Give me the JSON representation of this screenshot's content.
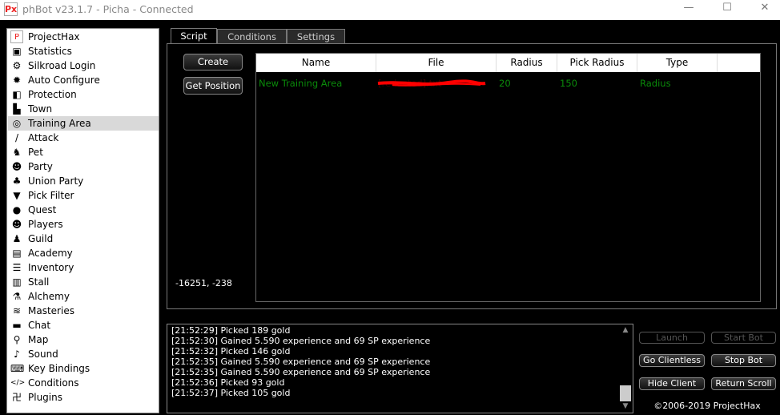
{
  "window": {
    "title": "phBot v23.1.7 - Picha - Connected",
    "logo": "Px"
  },
  "sidebar": {
    "items": [
      {
        "label": "ProjectHax",
        "icon": "projecthax-logo-icon"
      },
      {
        "label": "Statistics",
        "icon": "building-icon"
      },
      {
        "label": "Silkroad Login",
        "icon": "gears-icon"
      },
      {
        "label": "Auto Configure",
        "icon": "gear-a-icon"
      },
      {
        "label": "Protection",
        "icon": "shield-icon"
      },
      {
        "label": "Town",
        "icon": "town-icon"
      },
      {
        "label": "Training Area",
        "icon": "target-icon",
        "selected": true
      },
      {
        "label": "Attack",
        "icon": "sword-icon"
      },
      {
        "label": "Pet",
        "icon": "pet-icon"
      },
      {
        "label": "Party",
        "icon": "party-icon"
      },
      {
        "label": "Union Party",
        "icon": "union-icon"
      },
      {
        "label": "Pick Filter",
        "icon": "filter-icon"
      },
      {
        "label": "Quest",
        "icon": "quest-icon"
      },
      {
        "label": "Players",
        "icon": "players-icon"
      },
      {
        "label": "Guild",
        "icon": "guild-icon"
      },
      {
        "label": "Academy",
        "icon": "academy-icon"
      },
      {
        "label": "Inventory",
        "icon": "inventory-icon"
      },
      {
        "label": "Stall",
        "icon": "stall-icon"
      },
      {
        "label": "Alchemy",
        "icon": "alchemy-icon"
      },
      {
        "label": "Masteries",
        "icon": "masteries-icon"
      },
      {
        "label": "Chat",
        "icon": "chat-icon"
      },
      {
        "label": "Map",
        "icon": "map-pin-icon"
      },
      {
        "label": "Sound",
        "icon": "bell-icon"
      },
      {
        "label": "Key Bindings",
        "icon": "keyboard-icon"
      },
      {
        "label": "Conditions",
        "icon": "code-icon"
      },
      {
        "label": "Plugins",
        "icon": "plugins-icon"
      }
    ]
  },
  "tabs": [
    {
      "label": "Script",
      "active": true
    },
    {
      "label": "Conditions"
    },
    {
      "label": "Settings"
    }
  ],
  "buttons": {
    "create": "Create",
    "get_position": "Get Position"
  },
  "position": "-16251, -238",
  "table": {
    "columns": [
      "Name",
      "File",
      "Radius",
      "Pick Radius",
      "Type"
    ],
    "rows": [
      {
        "name": "New Training Area",
        "file": "[redacted].txt",
        "radius": "20",
        "pick_radius": "150",
        "type": "Radius"
      }
    ]
  },
  "log": [
    "[21:52:29] Picked 189 gold",
    "[21:52:30] Gained 5.590 experience and 69 SP experience",
    "[21:52:32] Picked 146 gold",
    "[21:52:35] Gained 5.590 experience and 69 SP experience",
    "[21:52:35] Gained 5.590 experience and 69 SP experience",
    "[21:52:36] Picked 93 gold",
    "[21:52:37] Picked 105 gold"
  ],
  "controls": {
    "launch": "Launch",
    "start_bot": "Start Bot",
    "go_clientless": "Go Clientless",
    "stop_bot": "Stop Bot",
    "hide_client": "Hide Client",
    "return_scroll": "Return Scroll"
  },
  "copyright": "©2006-2019 ProjectHax",
  "colors": {
    "row_text": "#0a8a0a",
    "redaction": "#ff0000"
  }
}
